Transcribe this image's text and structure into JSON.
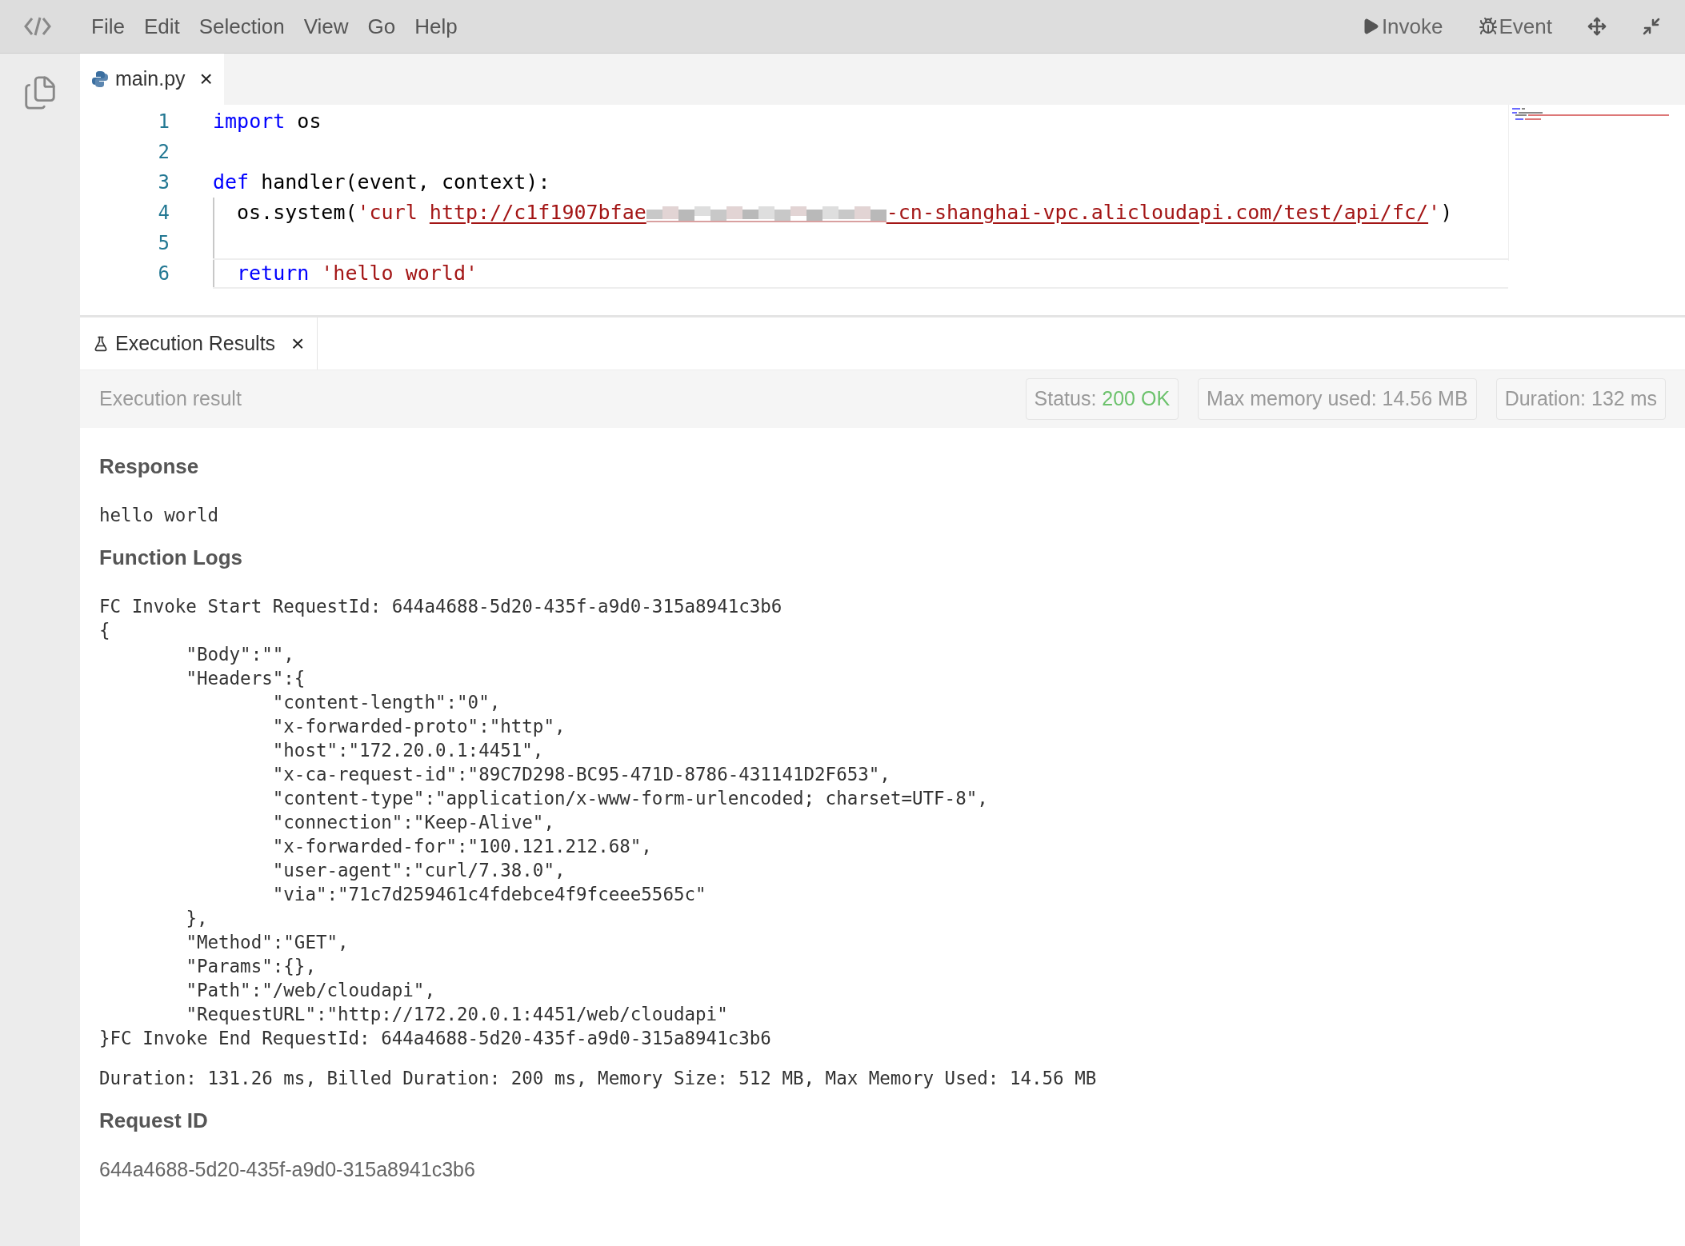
{
  "menu": [
    "File",
    "Edit",
    "Selection",
    "View",
    "Go",
    "Help"
  ],
  "toolbar": [
    {
      "kind": "play",
      "label": "Invoke"
    },
    {
      "kind": "bug",
      "label": "Event"
    },
    {
      "kind": "move"
    },
    {
      "kind": "collapse"
    }
  ],
  "editor_tab": {
    "label": "main.py",
    "close": "×"
  },
  "code_lines": [
    {
      "number": "1",
      "current": false,
      "indent_guide": false,
      "tokens": [
        {
          "kind": "keyword",
          "text": "import"
        },
        {
          "kind": "plain",
          "text": " os"
        }
      ]
    },
    {
      "number": "2",
      "current": false,
      "indent_guide": false
    },
    {
      "number": "3",
      "current": false,
      "indent_guide": false,
      "tokens": [
        {
          "kind": "keyword",
          "text": "def"
        },
        {
          "kind": "plain",
          "text": " handler(event, context):"
        }
      ]
    },
    {
      "number": "4",
      "current": false,
      "indent_guide": true,
      "tokens": [
        {
          "kind": "plain",
          "text": "os.system("
        },
        {
          "kind": "string",
          "text": "'curl "
        },
        {
          "kind": "link",
          "text": "http://c1f1907bfae"
        },
        {
          "kind": "redacted"
        },
        {
          "kind": "link",
          "text": "-cn-shanghai-vpc.alicloudapi.com/test/api/fc/"
        },
        {
          "kind": "string",
          "text": "'"
        },
        {
          "kind": "plain",
          "text": ")"
        }
      ]
    },
    {
      "number": "5",
      "current": false,
      "indent_guide": true
    },
    {
      "number": "6",
      "current": true,
      "indent_guide": true,
      "tokens": [
        {
          "kind": "keyword",
          "text": "return"
        },
        {
          "kind": "string",
          "text": "'hello world'"
        }
      ]
    }
  ],
  "results_tab": {
    "label": "Execution Results",
    "close": "×"
  },
  "results_header": {
    "title": "Execution result",
    "badges": [
      {
        "label": "Status:",
        "value": "200 OK",
        "color": "#6cc26c"
      },
      {
        "label": "Max memory used:",
        "value": "14.56 MB",
        "color": "#999999"
      },
      {
        "label": "Duration:",
        "value": "132 ms",
        "color": "#999999"
      }
    ]
  },
  "sections": [
    {
      "heading": "Response",
      "kind": "mono",
      "blocks": [
        [
          "hello world"
        ]
      ]
    },
    {
      "heading": "Function Logs",
      "kind": "mono",
      "blocks": [
        [
          "FC Invoke Start RequestId: 644a4688-5d20-435f-a9d0-315a8941c3b6",
          "{",
          "\t\"Body\":\"\",",
          "\t\"Headers\":{",
          "\t\t\"content-length\":\"0\",",
          "\t\t\"x-forwarded-proto\":\"http\",",
          "\t\t\"host\":\"172.20.0.1:4451\",",
          "\t\t\"x-ca-request-id\":\"89C7D298-BC95-471D-8786-431141D2F653\",",
          "\t\t\"content-type\":\"application/x-www-form-urlencoded; charset=UTF-8\",",
          "\t\t\"connection\":\"Keep-Alive\",",
          "\t\t\"x-forwarded-for\":\"100.121.212.68\",",
          "\t\t\"user-agent\":\"curl/7.38.0\",",
          "\t\t\"via\":\"71c7d259461c4fdebce4f9fceee5565c\"",
          "\t},",
          "\t\"Method\":\"GET\",",
          "\t\"Params\":{},",
          "\t\"Path\":\"/web/cloudapi\",",
          "\t\"RequestURL\":\"http://172.20.0.1:4451/web/cloudapi\"",
          "}FC Invoke End RequestId: 644a4688-5d20-435f-a9d0-315a8941c3b6"
        ],
        [
          "Duration: 131.26 ms, Billed Duration: 200 ms, Memory Size: 512 MB, Max Memory Used: 14.56 MB"
        ]
      ]
    },
    {
      "heading": "Request ID",
      "kind": "sans",
      "blocks": [
        [
          "644a4688-5d20-435f-a9d0-315a8941c3b6"
        ]
      ]
    }
  ]
}
